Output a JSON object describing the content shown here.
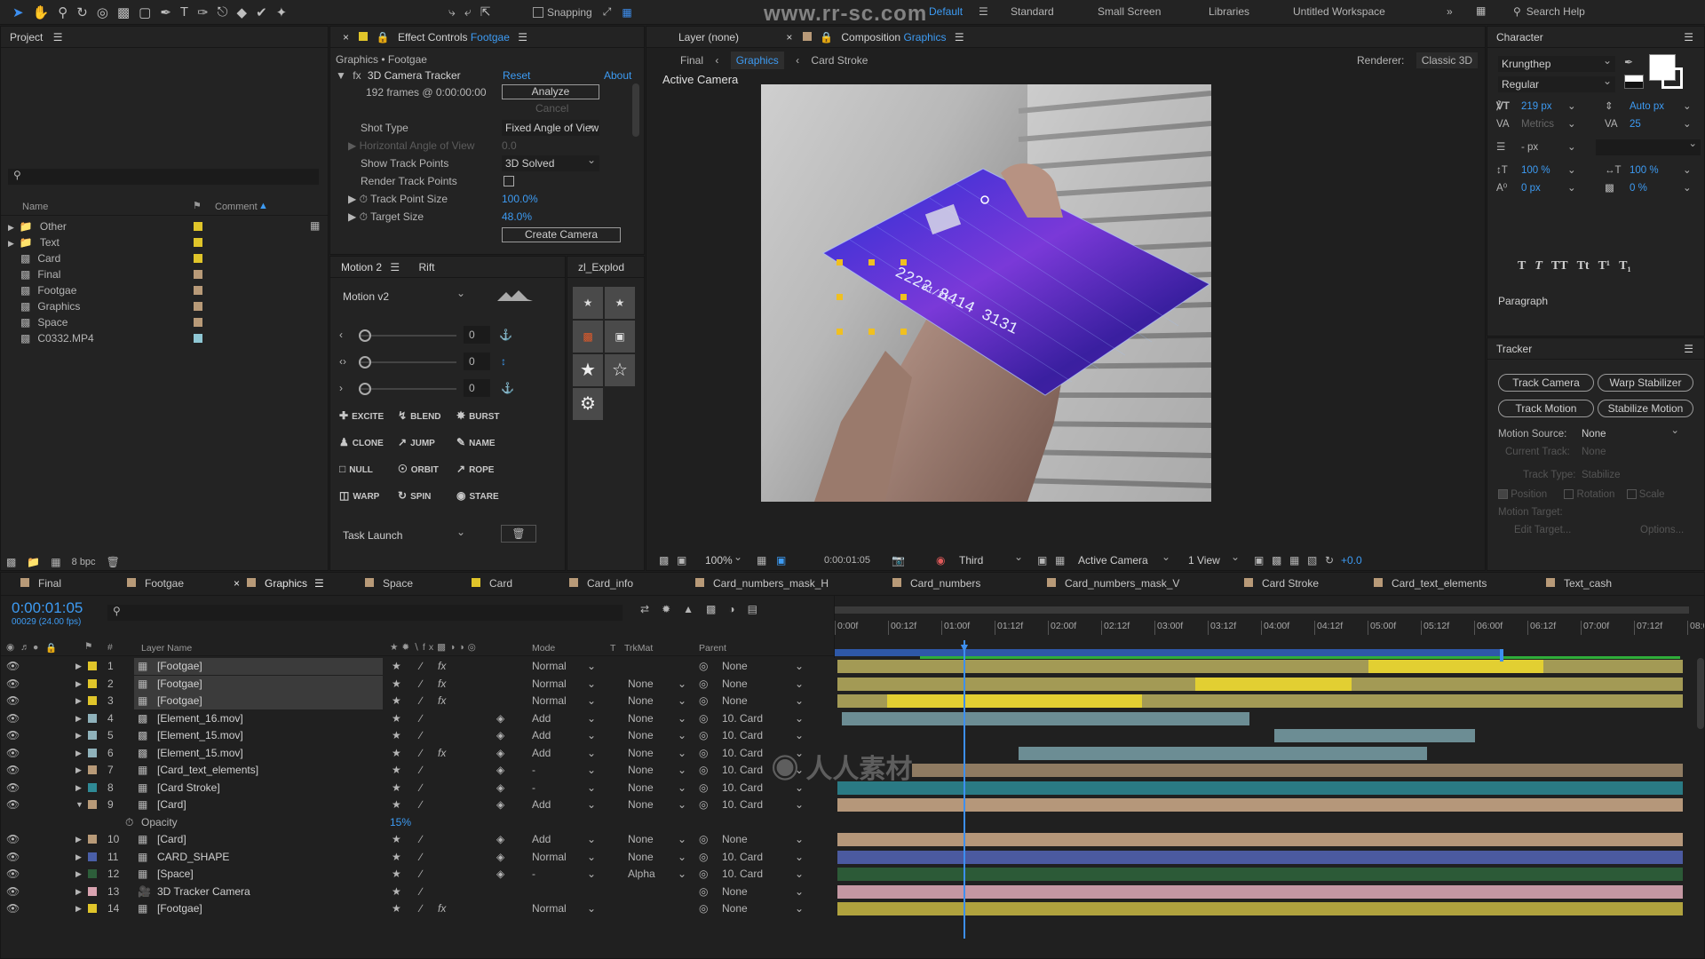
{
  "toolbar": {
    "snapping_label": "Snapping",
    "watermark": "www.rr-sc.com",
    "workspaces": [
      "Default",
      "Standard",
      "Small Screen",
      "Libraries",
      "Untitled Workspace"
    ],
    "search_placeholder": "Search Help"
  },
  "project": {
    "title": "Project",
    "col_name": "Name",
    "col_comment": "Comment",
    "items": [
      {
        "name": "Other",
        "color": "#e0c52a"
      },
      {
        "name": "Text",
        "color": "#e0c52a"
      },
      {
        "name": "Card",
        "color": "#e0c52a"
      },
      {
        "name": "Final",
        "color": "#b89a78"
      },
      {
        "name": "Footgae",
        "color": "#b89a78"
      },
      {
        "name": "Graphics",
        "color": "#b89a78"
      },
      {
        "name": "Space",
        "color": "#b89a78"
      },
      {
        "name": "C0332.MP4",
        "color": "#8fc7d4"
      }
    ],
    "bpc": "8 bpc"
  },
  "effect": {
    "tab_label": "Effect Controls",
    "tab_layer": "Footgae",
    "breadcrumb": "Graphics • Footgae",
    "effect_name": "3D Camera Tracker",
    "reset": "Reset",
    "about": "About",
    "frames": "192 frames @ 0:00:00:00",
    "analyze": "Analyze",
    "cancel": "Cancel",
    "shot_type_label": "Shot Type",
    "shot_type_value": "Fixed Angle of View",
    "hangle_label": "Horizontal Angle of View",
    "hangle_value": "0.0",
    "show_tp_label": "Show Track Points",
    "show_tp_value": "3D Solved",
    "render_tp_label": "Render Track Points",
    "tp_size_label": "Track Point Size",
    "tp_size_value": "100.0%",
    "target_size_label": "Target Size",
    "target_size_value": "48.0%",
    "create_camera": "Create Camera"
  },
  "motion": {
    "tab1": "Motion 2",
    "tab2": "Rift",
    "tab3": "zl_Explod",
    "preset": "Motion v2",
    "values": [
      "0",
      "0",
      "0"
    ],
    "actions": [
      "EXCITE",
      "BLEND",
      "BURST",
      "CLONE",
      "JUMP",
      "NAME",
      "NULL",
      "ORBIT",
      "ROPE",
      "WARP",
      "SPIN",
      "STARE"
    ],
    "task": "Task Launch"
  },
  "viewer": {
    "tab_layer": "Layer (none)",
    "tab_comp": "Composition",
    "tab_comp_name": "Graphics",
    "crumbs": [
      "Final",
      "Graphics",
      "Card Stroke"
    ],
    "renderer_label": "Renderer:",
    "renderer_value": "Classic 3D",
    "active_camera": "Active Camera",
    "card_number": "2222 8414 3131",
    "card_date": "01/21",
    "zoom": "100%",
    "timecode": "0:00:01:05",
    "resolution": "Third",
    "camera": "Active Camera",
    "views": "1 View",
    "exposure": "+0.0"
  },
  "character": {
    "title": "Character",
    "font": "Krungthep",
    "style": "Regular",
    "size": "219 px",
    "leading": "Auto px",
    "kerning": "Metrics",
    "tracking": "25",
    "stroke": "- px",
    "vscale": "100 %",
    "hscale": "100 %",
    "baseline": "0 px",
    "tsume": "0 %",
    "styles": [
      "T",
      "T",
      "TT",
      "Tt",
      "T¹",
      "T₁"
    ],
    "paragraph": "Paragraph"
  },
  "tracker": {
    "title": "Tracker",
    "buttons": [
      "Track Camera",
      "Warp Stabilizer",
      "Track Motion",
      "Stabilize Motion"
    ],
    "motion_source_label": "Motion Source:",
    "motion_source_value": "None",
    "current_track_label": "Current Track:",
    "current_track_value": "None",
    "track_type_label": "Track Type:",
    "track_type_value": "Stabilize",
    "checks": [
      "Position",
      "Rotation",
      "Scale"
    ],
    "motion_target": "Motion Target:",
    "edit_target": "Edit Target...",
    "options": "Options..."
  },
  "timeline": {
    "tabs": [
      {
        "name": "Final",
        "color": "#b89a78"
      },
      {
        "name": "Footgae",
        "color": "#b89a78"
      },
      {
        "name": "Graphics",
        "color": "#b89a78"
      },
      {
        "name": "Space",
        "color": "#b89a78"
      },
      {
        "name": "Card",
        "color": "#e0c52a"
      },
      {
        "name": "Card_info",
        "color": "#b89a78"
      },
      {
        "name": "Card_numbers_mask_H",
        "color": "#b89a78"
      },
      {
        "name": "Card_numbers",
        "color": "#b89a78"
      },
      {
        "name": "Card_numbers_mask_V",
        "color": "#b89a78"
      },
      {
        "name": "Card Stroke",
        "color": "#b89a78"
      },
      {
        "name": "Card_text_elements",
        "color": "#b89a78"
      },
      {
        "name": "Text_cash",
        "color": "#b89a78"
      }
    ],
    "timecode": "0:00:01:05",
    "frames": "00029 (24.00 fps)",
    "col_layer": "Layer Name",
    "col_mode": "Mode",
    "col_t": "T",
    "col_trkmat": "TrkMat",
    "col_parent": "Parent",
    "ruler": [
      "0:00f",
      "00:12f",
      "01:00f",
      "01:12f",
      "02:00f",
      "02:12f",
      "03:00f",
      "03:12f",
      "04:00f",
      "04:12f",
      "05:00f",
      "05:12f",
      "06:00f",
      "06:12f",
      "07:00f",
      "07:12f",
      "08:0"
    ],
    "layers": [
      {
        "num": "1",
        "name": "[Footgae]",
        "color": "#e0c52a",
        "mode": "Normal",
        "trk": "",
        "parent": "None",
        "fx": true,
        "bar": "#c6b63e",
        "sel": true
      },
      {
        "num": "2",
        "name": "[Footgae]",
        "color": "#e0c52a",
        "mode": "Normal",
        "trk": "None",
        "parent": "None",
        "fx": true,
        "bar": "#c6b63e",
        "sel": true
      },
      {
        "num": "3",
        "name": "[Footgae]",
        "color": "#e0c52a",
        "mode": "Normal",
        "trk": "None",
        "parent": "None",
        "fx": true,
        "bar": "#c6b63e",
        "sel": true
      },
      {
        "num": "4",
        "name": "[Element_16.mov]",
        "color": "#8fb2bb",
        "mode": "Add",
        "trk": "None",
        "parent": "10. Card",
        "fx": false,
        "bar": "#6c8d94"
      },
      {
        "num": "5",
        "name": "[Element_15.mov]",
        "color": "#8fb2bb",
        "mode": "Add",
        "trk": "None",
        "parent": "10. Card",
        "fx": false,
        "bar": "#6c8d94"
      },
      {
        "num": "6",
        "name": "[Element_15.mov]",
        "color": "#8fb2bb",
        "mode": "Add",
        "trk": "None",
        "parent": "10. Card",
        "fx": true,
        "bar": "#6c8d94"
      },
      {
        "num": "7",
        "name": "[Card_text_elements]",
        "color": "#b89a78",
        "mode": "-",
        "trk": "None",
        "parent": "10. Card",
        "fx": false,
        "bar": "#8f7b62"
      },
      {
        "num": "8",
        "name": "[Card Stroke]",
        "color": "#2f8a96",
        "mode": "-",
        "trk": "None",
        "parent": "10. Card",
        "fx": false,
        "bar": "#2a7a84"
      },
      {
        "num": "9",
        "name": "[Card]",
        "color": "#b89a78",
        "mode": "Add",
        "trk": "None",
        "parent": "10. Card",
        "fx": false,
        "bar": "#b5977a",
        "open": true
      },
      {
        "num": "10",
        "name": "[Card]",
        "color": "#b89a78",
        "mode": "Add",
        "trk": "None",
        "parent": "None",
        "fx": false,
        "bar": "#b5977a"
      },
      {
        "num": "11",
        "name": "CARD_SHAPE",
        "color": "#4a5fa8",
        "mode": "Normal",
        "trk": "None",
        "parent": "10. Card",
        "fx": false,
        "bar": "#4b5aa0"
      },
      {
        "num": "12",
        "name": "[Space]",
        "color": "#2d5e3a",
        "mode": "-",
        "trk": "Alpha",
        "parent": "10. Card",
        "fx": false,
        "bar": "#2c5a37"
      },
      {
        "num": "13",
        "name": "3D Tracker Camera",
        "color": "#d9a3b0",
        "mode": "",
        "trk": "",
        "parent": "None",
        "fx": false,
        "bar": "#c497a2"
      },
      {
        "num": "14",
        "name": "[Footgae]",
        "color": "#e0c52a",
        "mode": "Normal",
        "trk": "",
        "parent": "None",
        "fx": true,
        "bar": "#b0a23e"
      }
    ],
    "opacity_label": "Opacity",
    "opacity_value": "15%",
    "footer_watermark": "人人素材"
  }
}
